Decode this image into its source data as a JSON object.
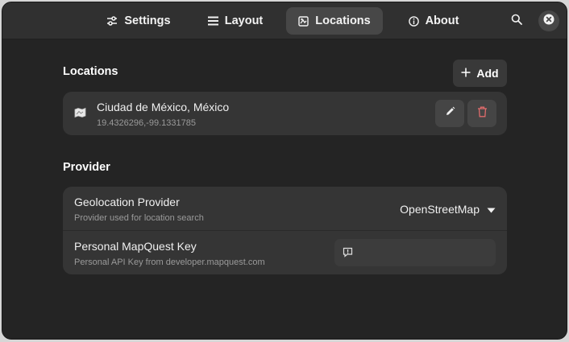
{
  "header": {
    "tabs": [
      {
        "label": "Settings",
        "icon": "sliders-icon",
        "active": false
      },
      {
        "label": "Layout",
        "icon": "list-icon",
        "active": false
      },
      {
        "label": "Locations",
        "icon": "map-icon",
        "active": true
      },
      {
        "label": "About",
        "icon": "info-icon",
        "active": false
      }
    ],
    "search_icon": "search-icon",
    "close_icon": "close-icon"
  },
  "locations": {
    "title": "Locations",
    "add_label": "Add",
    "items": [
      {
        "name": "Ciudad de México, México",
        "coords": "19.4326296,-99.1331785"
      }
    ]
  },
  "provider": {
    "title": "Provider",
    "geolocation": {
      "title": "Geolocation Provider",
      "subtitle": "Provider used for location search",
      "value": "OpenStreetMap"
    },
    "mapquest": {
      "title": "Personal MapQuest Key",
      "subtitle": "Personal API Key from developer.mapquest.com",
      "value": ""
    }
  },
  "colors": {
    "background": "#242424",
    "card": "#353535",
    "delete_accent": "#e06c6c"
  }
}
